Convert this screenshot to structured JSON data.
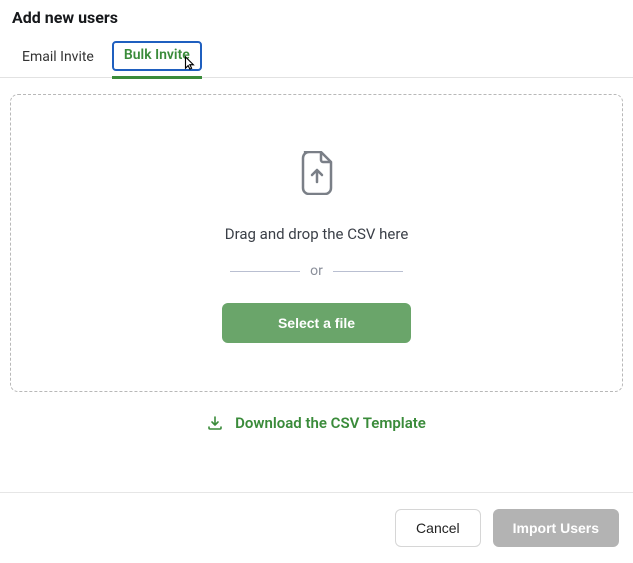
{
  "header": {
    "title": "Add new users"
  },
  "tabs": {
    "email": "Email Invite",
    "bulk": "Bulk Invite"
  },
  "dropzone": {
    "drag_text": "Drag and drop the CSV here",
    "or_text": "or",
    "select_label": "Select a file"
  },
  "download": {
    "label": "Download the CSV Template"
  },
  "footer": {
    "cancel": "Cancel",
    "import": "Import Users"
  }
}
